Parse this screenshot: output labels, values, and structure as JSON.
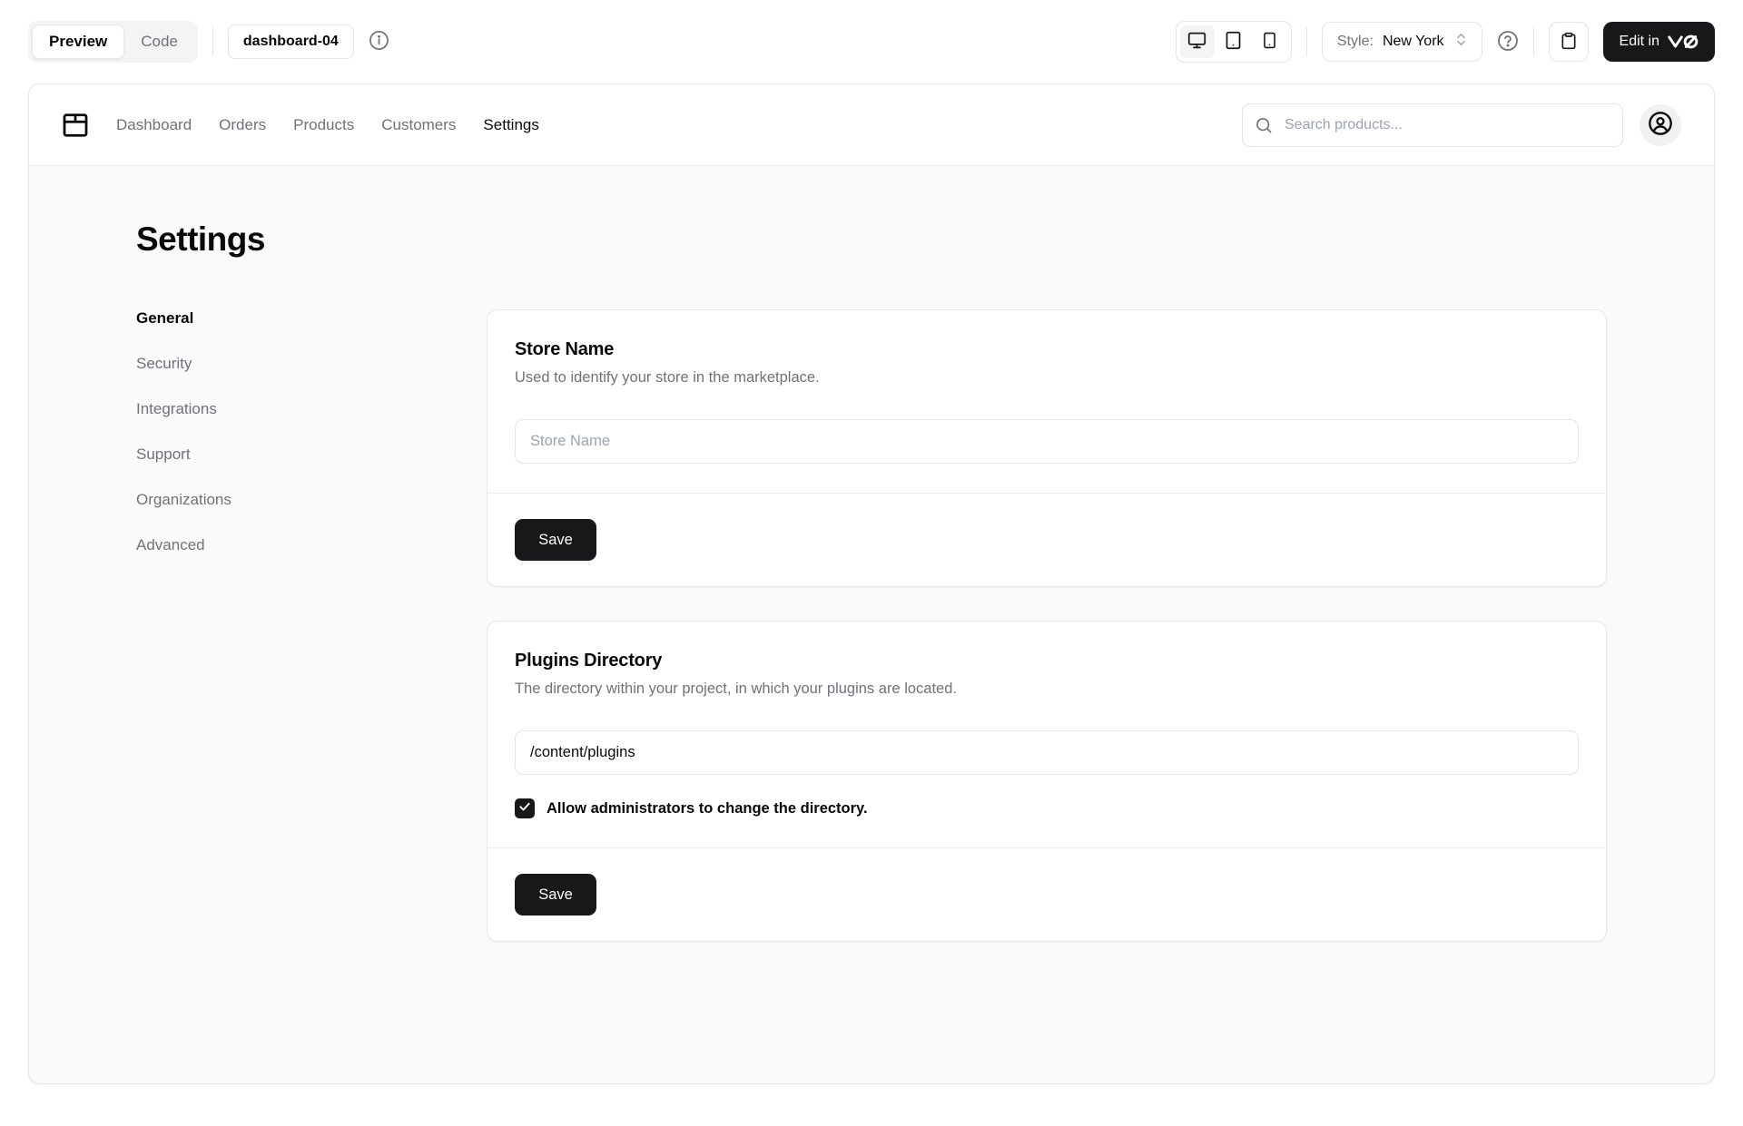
{
  "toolbar": {
    "tabs": [
      {
        "label": "Preview",
        "active": true
      },
      {
        "label": "Code",
        "active": false
      }
    ],
    "block_name": "dashboard-04",
    "style_label": "Style:",
    "style_value": "New York",
    "edit_button_label": "Edit in",
    "edit_button_logo": "v0"
  },
  "preview": {
    "nav": {
      "links": [
        {
          "label": "Dashboard",
          "active": false
        },
        {
          "label": "Orders",
          "active": false
        },
        {
          "label": "Products",
          "active": false
        },
        {
          "label": "Customers",
          "active": false
        },
        {
          "label": "Settings",
          "active": true
        }
      ],
      "search_placeholder": "Search products..."
    },
    "page": {
      "title": "Settings",
      "sidebar": [
        {
          "label": "General",
          "active": true
        },
        {
          "label": "Security",
          "active": false
        },
        {
          "label": "Integrations",
          "active": false
        },
        {
          "label": "Support",
          "active": false
        },
        {
          "label": "Organizations",
          "active": false
        },
        {
          "label": "Advanced",
          "active": false
        }
      ],
      "store_card": {
        "title": "Store Name",
        "description": "Used to identify your store in the marketplace.",
        "input_placeholder": "Store Name",
        "input_value": "",
        "save_label": "Save"
      },
      "plugins_card": {
        "title": "Plugins Directory",
        "description": "The directory within your project, in which your plugins are located.",
        "input_value": "/content/plugins",
        "checkbox_label": "Allow administrators to change the directory.",
        "checkbox_checked": true,
        "save_label": "Save"
      }
    }
  },
  "colors": {
    "accent_dark": "#18181b",
    "muted_text": "#71717a",
    "border": "#e4e4e7",
    "muted_bg": "#fafafa",
    "tab_bg": "#f4f4f5"
  }
}
